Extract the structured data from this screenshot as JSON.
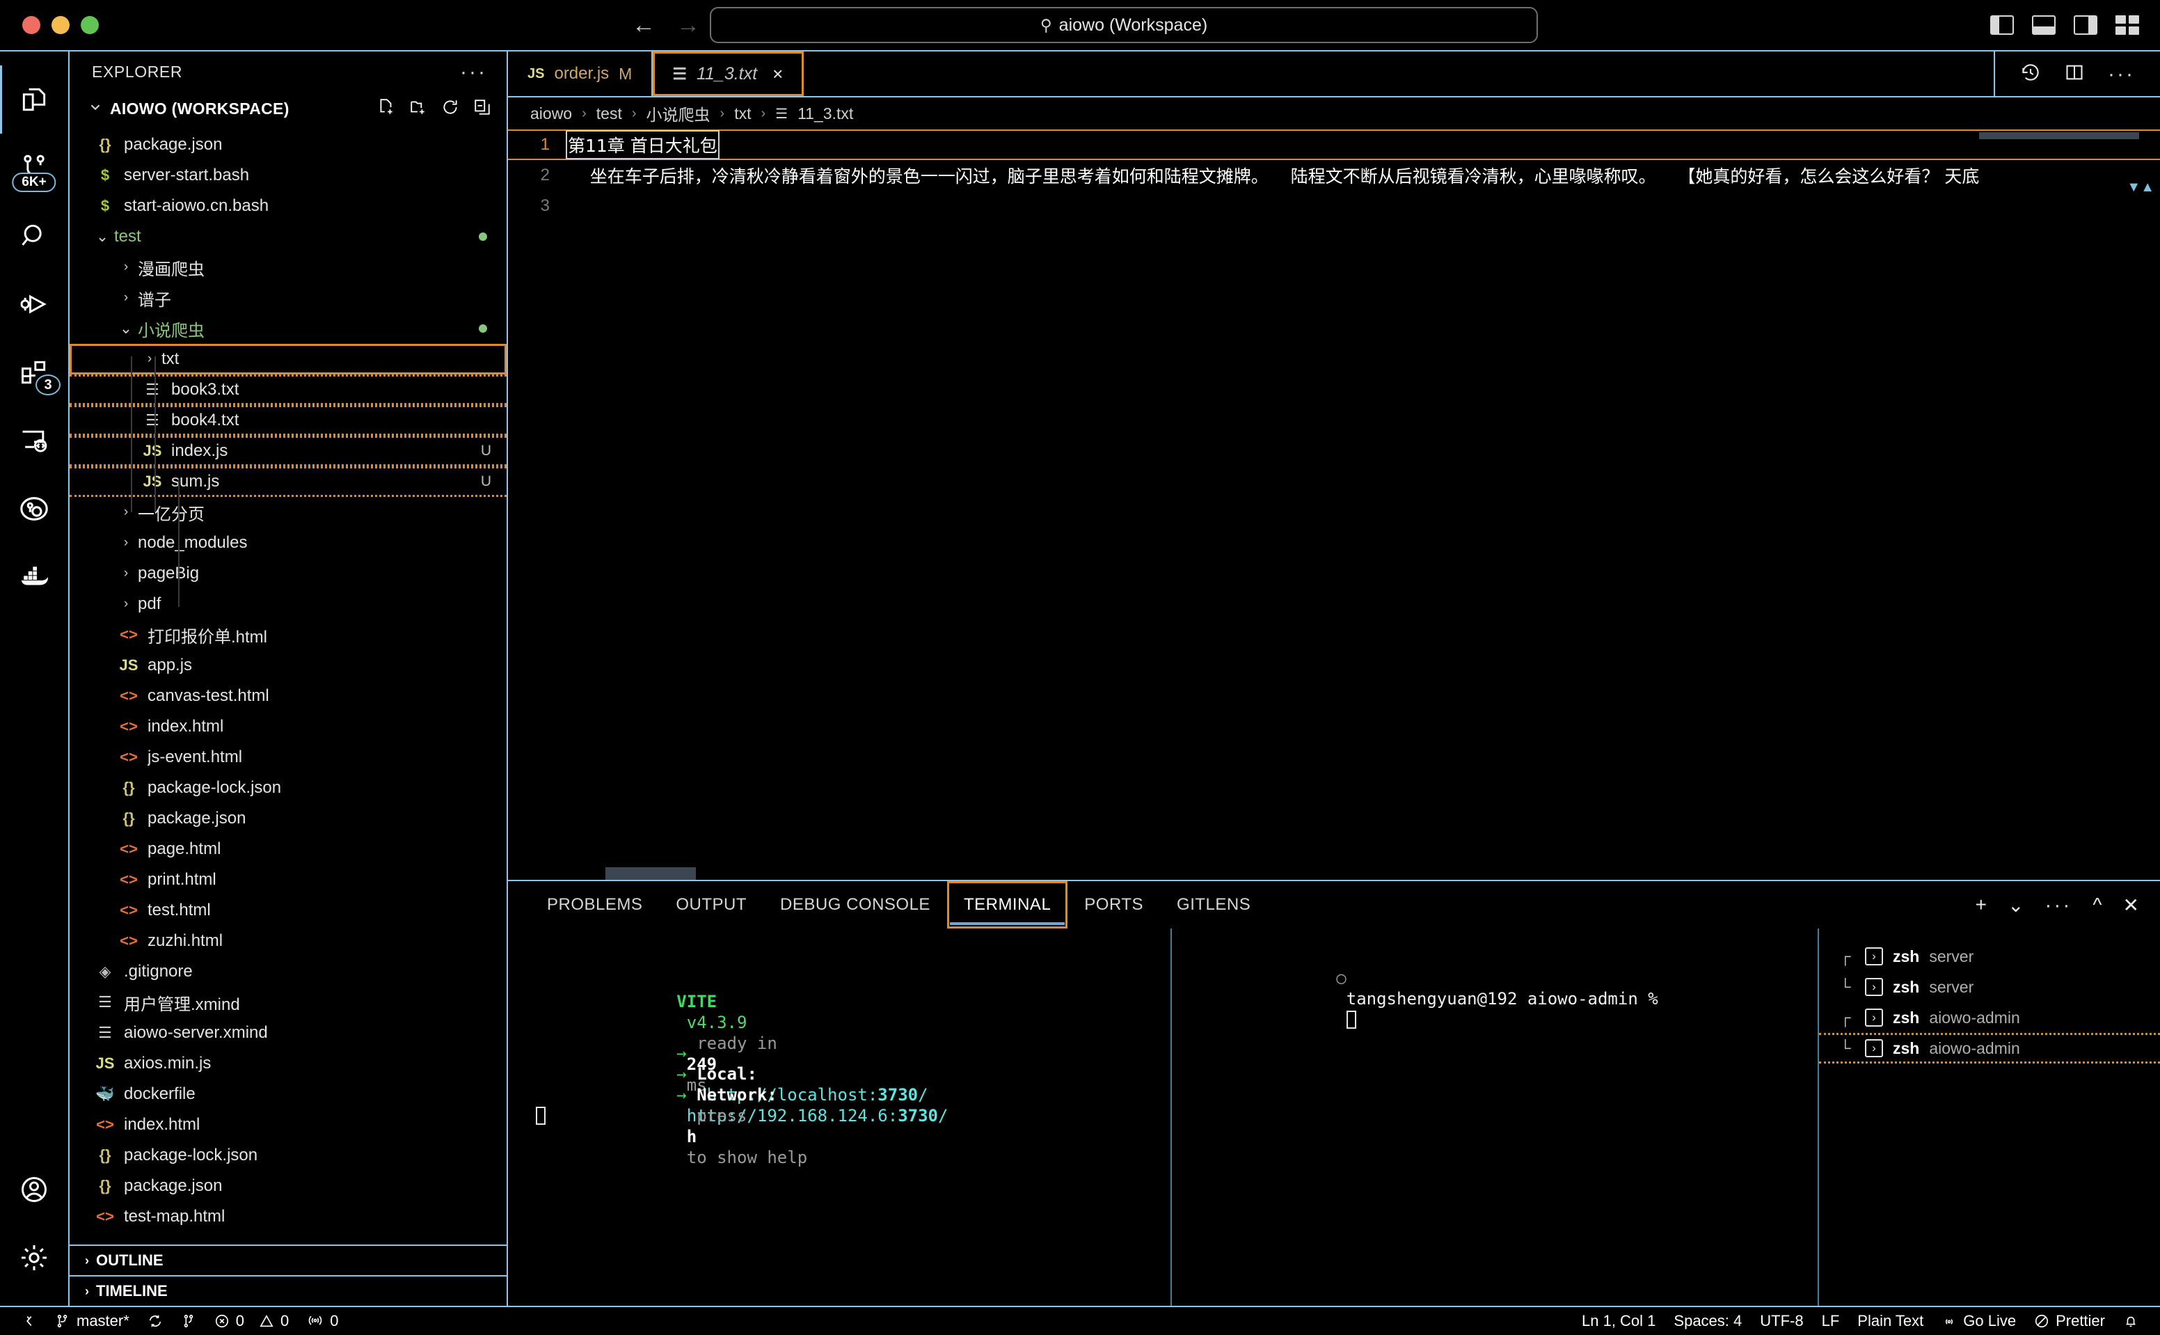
{
  "titlebar": {
    "search_value": "aiowo (Workspace)",
    "search_icon": "search-icon",
    "back_icon": "←",
    "forward_icon": "→"
  },
  "activitybar": {
    "items": [
      {
        "name": "explorer",
        "badge": ""
      },
      {
        "name": "source-control",
        "badge": "6K+"
      },
      {
        "name": "search",
        "badge": ""
      },
      {
        "name": "run-and-debug",
        "badge": ""
      },
      {
        "name": "extensions",
        "badge": "3"
      },
      {
        "name": "remote-explorer",
        "badge": ""
      },
      {
        "name": "gitlens",
        "badge": ""
      },
      {
        "name": "docker",
        "badge": ""
      }
    ],
    "account_icon": "account-icon",
    "settings_icon": "gear-icon"
  },
  "sidebar": {
    "title": "EXPLORER",
    "more_label": "···",
    "root_label": "AIOWO (WORKSPACE)",
    "actions": [
      "new-file-icon",
      "new-folder-icon",
      "refresh-icon",
      "collapse-all-icon"
    ],
    "sections": [
      {
        "label": "OUTLINE"
      },
      {
        "label": "TIMELINE"
      }
    ],
    "tree": [
      {
        "label": "package.json",
        "icon": "json",
        "indent": 1,
        "type": "file"
      },
      {
        "label": "server-start.bash",
        "icon": "sh",
        "indent": 1,
        "type": "file"
      },
      {
        "label": "start-aiowo.cn.bash",
        "icon": "sh",
        "indent": 1,
        "type": "file"
      },
      {
        "label": "test",
        "icon": "none",
        "indent": 1,
        "type": "folder",
        "open": true,
        "green": true,
        "dot": true
      },
      {
        "label": "漫画爬虫",
        "icon": "none",
        "indent": 2,
        "type": "folder",
        "open": false
      },
      {
        "label": "谱子",
        "icon": "none",
        "indent": 2,
        "type": "folder",
        "open": false
      },
      {
        "label": "小说爬虫",
        "icon": "none",
        "indent": 2,
        "type": "folder",
        "open": true,
        "green": true,
        "dot": true
      },
      {
        "label": "txt",
        "icon": "none",
        "indent": 3,
        "type": "folder",
        "open": false,
        "sel": "solid"
      },
      {
        "label": "book3.txt",
        "icon": "txt",
        "indent": 3,
        "type": "file",
        "sel": "dash"
      },
      {
        "label": "book4.txt",
        "icon": "txt",
        "indent": 3,
        "type": "file",
        "sel": "dash"
      },
      {
        "label": "index.js",
        "icon": "js",
        "indent": 3,
        "type": "file",
        "git": "U",
        "sel": "dash"
      },
      {
        "label": "sum.js",
        "icon": "js",
        "indent": 3,
        "type": "file",
        "git": "U",
        "sel": "dash"
      },
      {
        "label": "一亿分页",
        "icon": "none",
        "indent": 2,
        "type": "folder",
        "open": false
      },
      {
        "label": "node_modules",
        "icon": "none",
        "indent": 2,
        "type": "folder",
        "open": false
      },
      {
        "label": "pageBig",
        "icon": "none",
        "indent": 2,
        "type": "folder",
        "open": false
      },
      {
        "label": "pdf",
        "icon": "none",
        "indent": 2,
        "type": "folder",
        "open": false
      },
      {
        "label": "打印报价单.html",
        "icon": "html",
        "indent": 2,
        "type": "file"
      },
      {
        "label": "app.js",
        "icon": "js",
        "indent": 2,
        "type": "file"
      },
      {
        "label": "canvas-test.html",
        "icon": "html",
        "indent": 2,
        "type": "file"
      },
      {
        "label": "index.html",
        "icon": "html",
        "indent": 2,
        "type": "file"
      },
      {
        "label": "js-event.html",
        "icon": "html",
        "indent": 2,
        "type": "file"
      },
      {
        "label": "package-lock.json",
        "icon": "json",
        "indent": 2,
        "type": "file"
      },
      {
        "label": "package.json",
        "icon": "json",
        "indent": 2,
        "type": "file"
      },
      {
        "label": "page.html",
        "icon": "html",
        "indent": 2,
        "type": "file"
      },
      {
        "label": "print.html",
        "icon": "html",
        "indent": 2,
        "type": "file"
      },
      {
        "label": "test.html",
        "icon": "html",
        "indent": 2,
        "type": "file"
      },
      {
        "label": "zuzhi.html",
        "icon": "html",
        "indent": 2,
        "type": "file"
      },
      {
        "label": ".gitignore",
        "icon": "git",
        "indent": 1,
        "type": "file"
      },
      {
        "label": "用户管理.xmind",
        "icon": "txt",
        "indent": 1,
        "type": "file"
      },
      {
        "label": "aiowo-server.xmind",
        "icon": "txt",
        "indent": 1,
        "type": "file"
      },
      {
        "label": "axios.min.js",
        "icon": "js",
        "indent": 1,
        "type": "file"
      },
      {
        "label": "dockerfile",
        "icon": "dock",
        "indent": 1,
        "type": "file"
      },
      {
        "label": "index.html",
        "icon": "html",
        "indent": 1,
        "type": "file"
      },
      {
        "label": "package-lock.json",
        "icon": "json",
        "indent": 1,
        "type": "file"
      },
      {
        "label": "package.json",
        "icon": "json",
        "indent": 1,
        "type": "file"
      },
      {
        "label": "test-map.html",
        "icon": "html",
        "indent": 1,
        "type": "file"
      }
    ]
  },
  "editor": {
    "tabs": [
      {
        "label": "order.js",
        "icon": "JS",
        "marker": "M",
        "state": "inactive"
      },
      {
        "label": "11_3.txt",
        "icon": "txt",
        "marker": "",
        "state": "active-preview",
        "close": "×"
      }
    ],
    "tab_actions": [
      "history-icon",
      "split-editor-icon",
      "more-actions-icon"
    ],
    "breadcrumb": [
      "aiowo",
      "test",
      "小说爬虫",
      "txt",
      "11_3.txt"
    ],
    "breadcrumb_sep": "›",
    "lines": [
      {
        "num": "1",
        "text": "第11章 首日大礼包",
        "current": true
      },
      {
        "num": "2",
        "text": "    坐在车子后排，冷清秋冷静看着窗外的景色一一闪过，脑子里思考着如何和陆程文摊牌。    陆程文不断从后视镜看冷清秋，心里喙喙称叹。    【她真的好看，怎么会这么好看？ 天底",
        "current": false
      },
      {
        "num": "3",
        "text": "",
        "current": false
      }
    ]
  },
  "panel": {
    "tabs": [
      {
        "label": "PROBLEMS",
        "active": false
      },
      {
        "label": "OUTPUT",
        "active": false
      },
      {
        "label": "DEBUG CONSOLE",
        "active": false
      },
      {
        "label": "TERMINAL",
        "active": true
      },
      {
        "label": "PORTS",
        "active": false
      },
      {
        "label": "GITLENS",
        "active": false
      }
    ],
    "actions": [
      "add-terminal-icon",
      "chevron-down-icon",
      "more-actions-icon",
      "chevron-up-icon",
      "close-icon"
    ],
    "terminal_left": {
      "vite_label": "VITE",
      "vite_version": "v4.3.9",
      "ready_label": "ready in",
      "ready_time": "249",
      "ready_unit": "ms",
      "local_label": "Local:",
      "local_url_prefix": "http://localhost:",
      "local_port": "3730",
      "local_url_suffix": "/",
      "network_label": "Network:",
      "network_url_prefix": "http://192.168.124.6:",
      "network_port": "3730",
      "network_url_suffix": "/",
      "help_pre": "press",
      "help_key": "h",
      "help_post": "to show help",
      "arrow": "→"
    },
    "terminal_right": {
      "prompt": "tangshengyuan@192 aiowo-admin %",
      "bullet": "○"
    },
    "terminal_list": [
      {
        "tree": "┌",
        "shell": "zsh",
        "cwd": "server",
        "selected": false
      },
      {
        "tree": "└",
        "shell": "zsh",
        "cwd": "server",
        "selected": false
      },
      {
        "tree": "┌",
        "shell": "zsh",
        "cwd": "aiowo-admin",
        "selected": false
      },
      {
        "tree": "└",
        "shell": "zsh",
        "cwd": "aiowo-admin",
        "selected": true
      }
    ]
  },
  "statusbar": {
    "left": [
      {
        "name": "remote-indicator",
        "icon": "≶",
        "label": ""
      },
      {
        "name": "git-branch",
        "icon": "branch",
        "label": "master*"
      },
      {
        "name": "sync-changes",
        "icon": "sync",
        "label": ""
      },
      {
        "name": "git-fork",
        "icon": "fork",
        "label": ""
      },
      {
        "name": "errors",
        "icon": "error",
        "label": "0"
      },
      {
        "name": "warnings",
        "icon": "warn",
        "label": "0"
      },
      {
        "name": "radio-tower",
        "icon": "tower",
        "label": "0"
      }
    ],
    "right": [
      {
        "name": "cursor-position",
        "icon": "",
        "label": "Ln 1, Col 1"
      },
      {
        "name": "indentation",
        "icon": "",
        "label": "Spaces: 4"
      },
      {
        "name": "encoding",
        "icon": "",
        "label": "UTF-8"
      },
      {
        "name": "eol",
        "icon": "",
        "label": "LF"
      },
      {
        "name": "language-mode",
        "icon": "",
        "label": "Plain Text"
      },
      {
        "name": "go-live",
        "icon": "tower",
        "label": "Go Live"
      },
      {
        "name": "prettier",
        "icon": "slash",
        "label": "Prettier"
      },
      {
        "name": "notifications",
        "icon": "bell",
        "label": ""
      }
    ]
  },
  "colors": {
    "accent_orange": "#e08a2e",
    "border_blue": "#8fc5e8",
    "green_git": "#89c77e",
    "modified_amber": "#cfa76c"
  }
}
